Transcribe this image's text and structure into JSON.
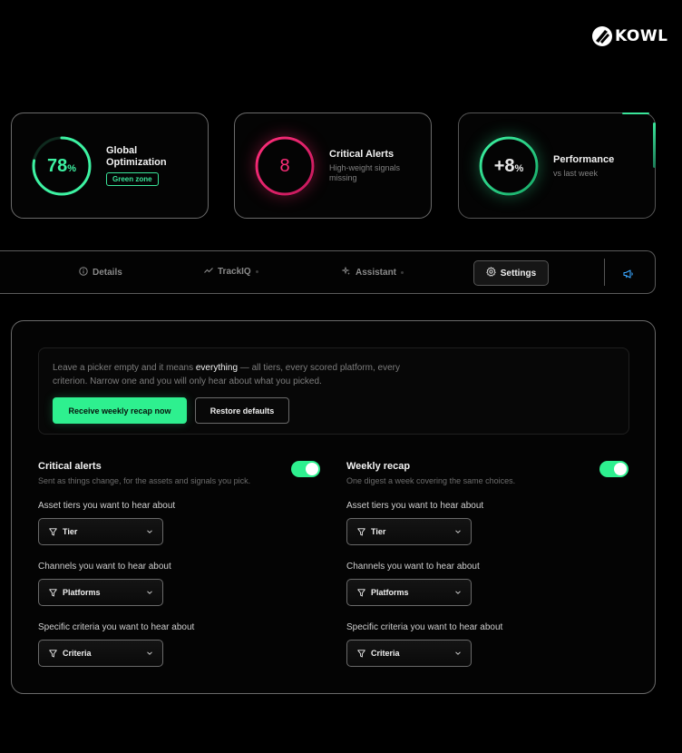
{
  "brand": {
    "name": "KOWL"
  },
  "cards": [
    {
      "value": "78",
      "unit": "%",
      "title": "Global Optimization",
      "badge": "Green zone",
      "progress": 0.78,
      "color": "#3df2a2"
    },
    {
      "value": "8",
      "title": "Critical Alerts",
      "subtitle": "High-weight signals missing",
      "color": "#ff2e7a"
    },
    {
      "value": "+8",
      "unit": "%",
      "title": "Performance",
      "subtitle": "vs last week",
      "color": "#3df2a2"
    }
  ],
  "tabs": {
    "details": "Details",
    "trackiq": "TrackIQ",
    "assistant": "Assistant",
    "settings": "Settings"
  },
  "info": {
    "text_before": "Leave a picker empty and it means ",
    "text_bold": "everything",
    "text_after": " — all tiers, every scored platform, every criterion. Narrow one and you will only hear about what you picked.",
    "primary_button": "Receive weekly recap now",
    "secondary_button": "Restore defaults"
  },
  "columns": [
    {
      "title": "Critical alerts",
      "subtitle": "Sent as things change, for the assets and signals you pick.",
      "enabled": true,
      "fields": [
        {
          "label": "Asset tiers you want to hear about",
          "value": "Tier"
        },
        {
          "label": "Channels you want to hear about",
          "value": "Platforms"
        },
        {
          "label": "Specific criteria you want to hear about",
          "value": "Criteria"
        }
      ]
    },
    {
      "title": "Weekly recap",
      "subtitle": "One digest a week covering the same choices.",
      "enabled": true,
      "fields": [
        {
          "label": "Asset tiers you want to hear about",
          "value": "Tier"
        },
        {
          "label": "Channels you want to hear about",
          "value": "Platforms"
        },
        {
          "label": "Specific criteria you want to hear about",
          "value": "Criteria"
        }
      ]
    }
  ],
  "icons": {
    "logo": "kowl-logo-icon",
    "details": "info-circle-icon",
    "trackiq": "trend-line-icon",
    "assistant": "sparkle-icon",
    "settings": "gear-icon",
    "announce": "megaphone-icon",
    "filter": "filter-icon",
    "dropdown": "chevron-down-icon"
  },
  "colors": {
    "accent": "#2ef08f",
    "alert": "#ff2e7a",
    "background": "#000000"
  }
}
